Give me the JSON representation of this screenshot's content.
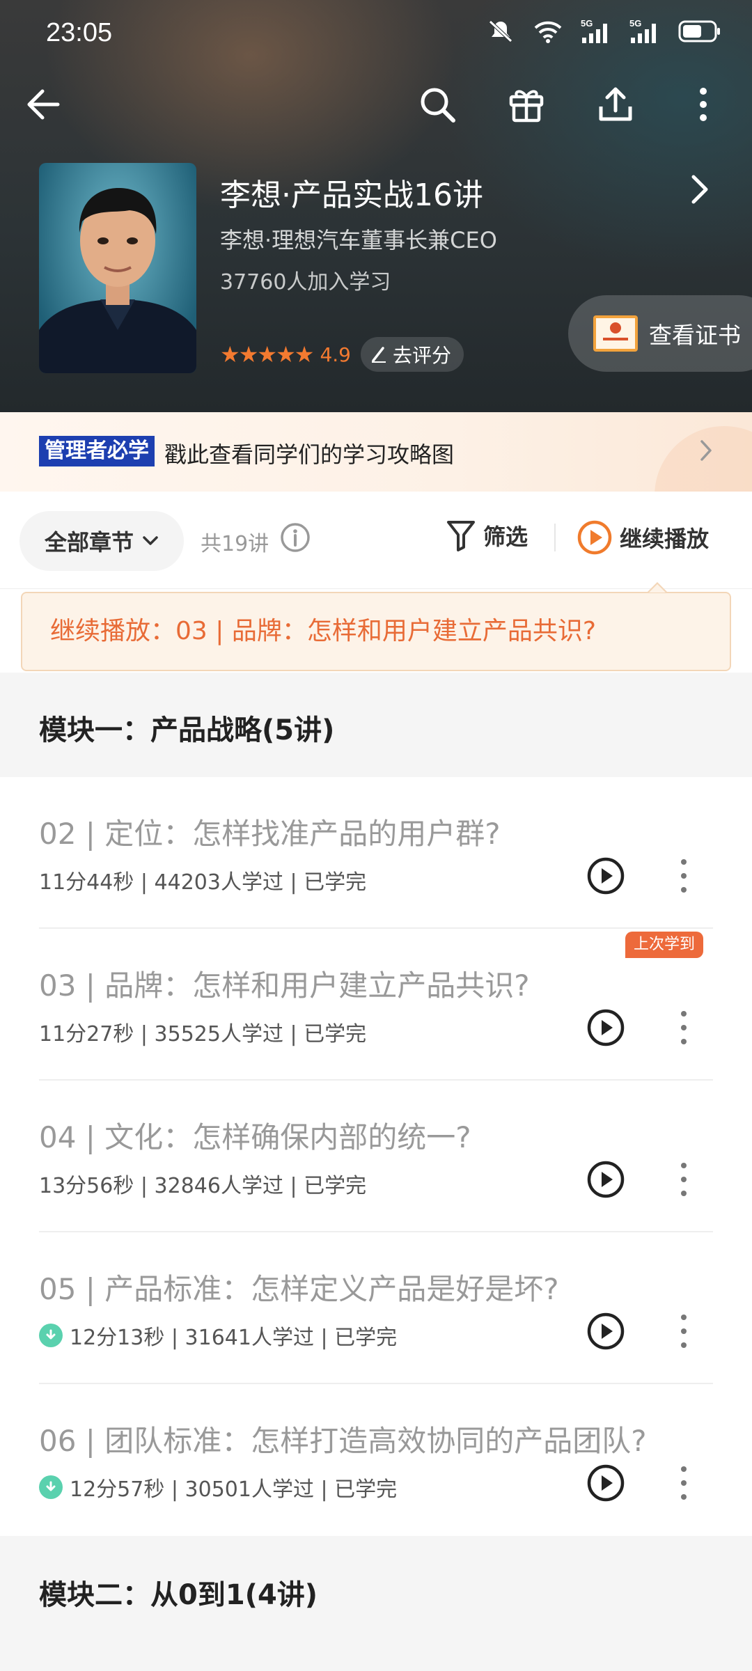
{
  "status": {
    "time": "23:05"
  },
  "course": {
    "title": "李想·产品实战16讲",
    "subtitle": "李想·理想汽车董事长兼CEO",
    "learners": "37760人加入学习",
    "stars": "★★★★★",
    "rating": "4.9",
    "rate_label": "去评分",
    "certificate_label": "查看证书"
  },
  "banner": {
    "tag": "管理者必学",
    "text": "戳此查看同学们的学习攻略图"
  },
  "filter": {
    "chapter_label": "全部章节",
    "total": "共19讲",
    "filter_label": "筛选",
    "continue_label": "继续播放"
  },
  "tip": {
    "text": "继续播放：03 | 品牌：怎样和用户建立产品共识?"
  },
  "modules": [
    {
      "title": "模块一：产品战略(5讲)"
    },
    {
      "title": "模块二：从0到1(4讲)"
    }
  ],
  "lessons": [
    {
      "title": "02 | 定位：怎样找准产品的用户群?",
      "meta": "11分44秒 | 44203人学过 | 已学完",
      "downloaded": false,
      "last": false
    },
    {
      "title": "03 | 品牌：怎样和用户建立产品共识?",
      "meta": "11分27秒 | 35525人学过 | 已学完",
      "downloaded": false,
      "last": true,
      "badge": "上次学到"
    },
    {
      "title": "04 | 文化：怎样确保内部的统一?",
      "meta": "13分56秒 | 32846人学过 | 已学完",
      "downloaded": false,
      "last": false
    },
    {
      "title": "05 | 产品标准：怎样定义产品是好是坏?",
      "meta": "12分13秒 | 31641人学过 | 已学完",
      "downloaded": true,
      "last": false
    },
    {
      "title": "06 | 团队标准：怎样打造高效协同的产品团队?",
      "meta": "12分57秒 | 30501人学过 | 已学完",
      "downloaded": true,
      "last": false
    }
  ],
  "colors": {
    "accent": "#e86b36",
    "star": "#f37a30",
    "download": "#5ad1ae",
    "tag_bg": "#1d3fb0"
  },
  "icons": [
    "back-icon",
    "search-icon",
    "gift-icon",
    "share-icon",
    "more-vertical-icon",
    "chevron-right-icon",
    "edit-icon",
    "certificate-icon",
    "chevron-down-icon",
    "info-icon",
    "filter-icon",
    "play-circle-icon",
    "download-icon"
  ]
}
